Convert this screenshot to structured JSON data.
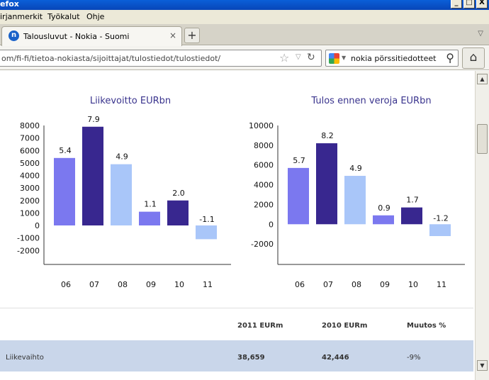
{
  "window": {
    "title": "efox",
    "buttons": {
      "minimize": "_",
      "maximize": "□",
      "close": "X"
    }
  },
  "menu": [
    "irjanmerkit",
    "Työkalut",
    "Ohje"
  ],
  "tab": {
    "title": "Talousluvut - Nokia - Suomi",
    "close": "×",
    "favicon": "n"
  },
  "newtab": "+",
  "tablist": "▽",
  "urlbar": {
    "url": "om/fi-fi/tietoa-nokiasta/sijoittajat/tulostiedot/tulostiedot/"
  },
  "search": {
    "value": "nokia pörssitiedotteet"
  },
  "colors": {
    "periwinkle": "#7b78ef",
    "navy": "#38278f",
    "light": "#a9c6f9"
  },
  "chart_data": [
    {
      "type": "bar",
      "title": "Liikevoitto EURbn",
      "categories": [
        "06",
        "07",
        "08",
        "09",
        "10",
        "11"
      ],
      "values": [
        5400,
        7900,
        4900,
        1100,
        2000,
        -1100
      ],
      "data_labels": [
        "5.4",
        "7.9",
        "4.9",
        "1.1",
        "2.0",
        "-1.1"
      ],
      "colors": [
        "#7b78ef",
        "#38278f",
        "#a9c6f9",
        "#7b78ef",
        "#38278f",
        "#a9c6f9"
      ],
      "yticks": [
        8000,
        7000,
        6000,
        5000,
        4000,
        3000,
        2000,
        1000,
        0,
        -1000,
        -2000
      ],
      "ytick_labels": [
        "8000",
        "7000",
        "6000",
        "5000",
        "4000",
        "3000",
        "2000",
        "1000",
        "0",
        "-1000",
        "-2000"
      ],
      "ylim": [
        -3000,
        8000
      ],
      "grid": false,
      "legend": "none"
    },
    {
      "type": "bar",
      "title": "Tulos ennen veroja EURbn",
      "categories": [
        "06",
        "07",
        "08",
        "09",
        "10",
        "11"
      ],
      "values": [
        5700,
        8200,
        4900,
        900,
        1700,
        -1200
      ],
      "data_labels": [
        "5.7",
        "8.2",
        "4.9",
        "0.9",
        "1.7",
        "-1.2"
      ],
      "colors": [
        "#7b78ef",
        "#38278f",
        "#a9c6f9",
        "#7b78ef",
        "#38278f",
        "#a9c6f9"
      ],
      "yticks": [
        10000,
        8000,
        6000,
        4000,
        2000,
        0,
        -2000
      ],
      "ytick_labels": [
        "10000",
        "8000",
        "6000",
        "4000",
        "2000",
        "0",
        "-2000"
      ],
      "ylim": [
        -4000,
        10000
      ],
      "grid": false,
      "legend": "none"
    }
  ],
  "table": {
    "headers": [
      "2011 EURm",
      "2010 EURm",
      "Muutos %"
    ],
    "rows": [
      {
        "label": "Liikevaihto",
        "v2011": "38,659",
        "v2010": "42,446",
        "change": "-9%"
      }
    ]
  },
  "scrollbar": {
    "up": "▲",
    "down": "▼"
  }
}
